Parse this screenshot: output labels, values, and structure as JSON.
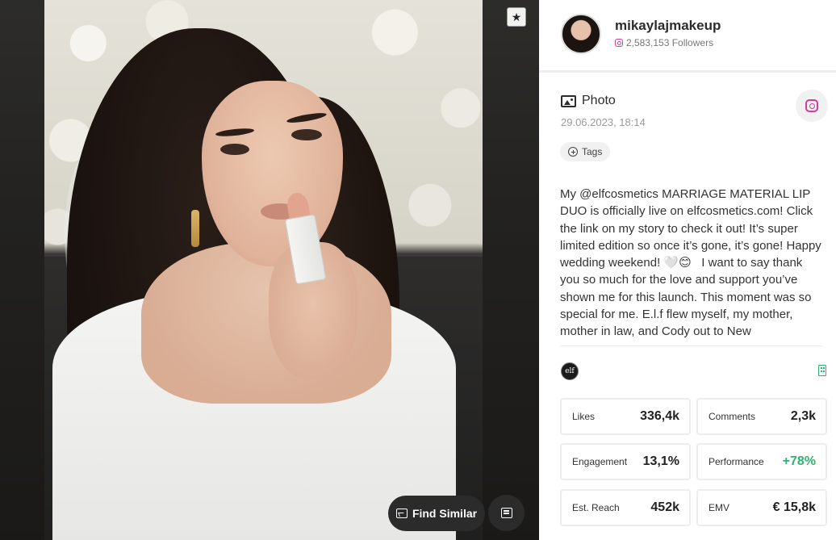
{
  "media": {
    "star_icon": "star-sparkle-icon",
    "find_similar_label": "Find Similar",
    "find_similar_icon": "image-search-icon",
    "comment_icon": "comment-icon"
  },
  "profile": {
    "username": "mikaylajmakeup",
    "followers": "2,583,153 Followers",
    "platform_icon": "instagram-icon"
  },
  "post": {
    "type_label": "Photo",
    "type_icon": "photo-icon",
    "date": "29.06.2023, 18:14",
    "tags_label": "Tags",
    "caption": "My @elfcosmetics MARRIAGE MATERIAL LIP DUO is officially live on elfcosmetics.com! Click the link on my story to check it out! It’s super limited edition so once it’s gone, it’s gone! Happy wedding weekend! 🤍😊 ​ ​ I want to say thank you so much for the love and support you’ve shown me for this launch. This moment was so special for me. E.l.f flew myself, my mother, mother in law, and Cody out to New",
    "brand_logo_text": "elf",
    "building_icon": "building-icon"
  },
  "stats": [
    {
      "label": "Likes",
      "value": "336,4k"
    },
    {
      "label": "Comments",
      "value": "2,3k"
    },
    {
      "label": "Engagement",
      "value": "13,1%"
    },
    {
      "label": "Performance",
      "value": "+78%"
    },
    {
      "label": "Est. Reach",
      "value": "452k"
    },
    {
      "label": "EMV",
      "value": "€ 15,8k"
    }
  ],
  "colors": {
    "instagram": "#d63a9a",
    "positive": "#2db36f",
    "panel_bg": "#ffffff",
    "button_dark": "#2b2b2b"
  }
}
